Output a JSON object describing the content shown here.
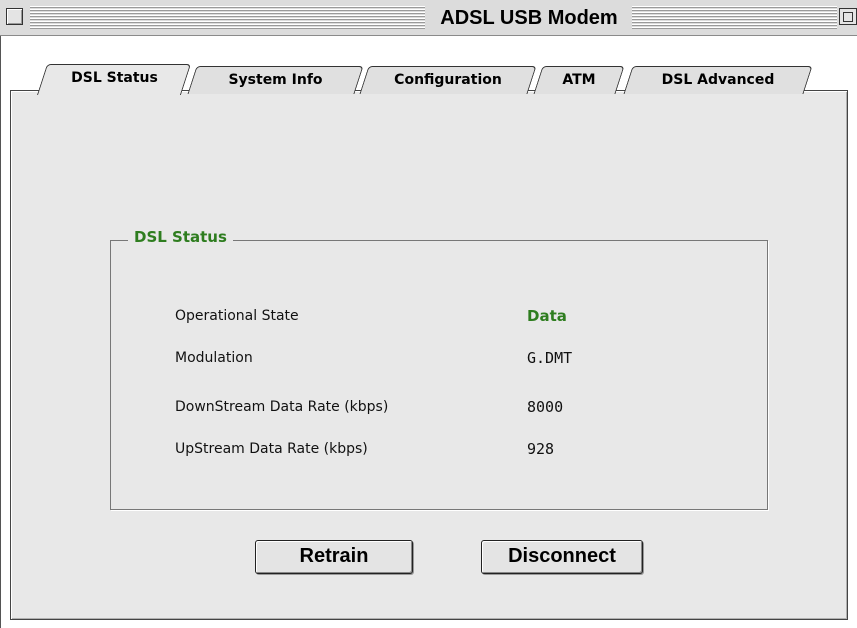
{
  "window": {
    "title": "ADSL USB Modem"
  },
  "tabs": [
    {
      "label": "DSL Status",
      "active": true
    },
    {
      "label": "System Info",
      "active": false
    },
    {
      "label": "Configuration",
      "active": false
    },
    {
      "label": "ATM",
      "active": false
    },
    {
      "label": "DSL Advanced",
      "active": false
    }
  ],
  "dsl_status": {
    "group_title": "DSL Status",
    "rows": [
      {
        "label": "Operational State",
        "value": "Data"
      },
      {
        "label": "Modulation",
        "value": "G.DMT"
      },
      {
        "label": "DownStream Data Rate (kbps)",
        "value": "8000"
      },
      {
        "label": "UpStream Data Rate (kbps)",
        "value": "928"
      }
    ]
  },
  "buttons": {
    "retrain": "Retrain",
    "disconnect": "Disconnect"
  },
  "colors": {
    "accent_green": "#2e7d1f",
    "panel_bg": "#e8e8e8"
  }
}
